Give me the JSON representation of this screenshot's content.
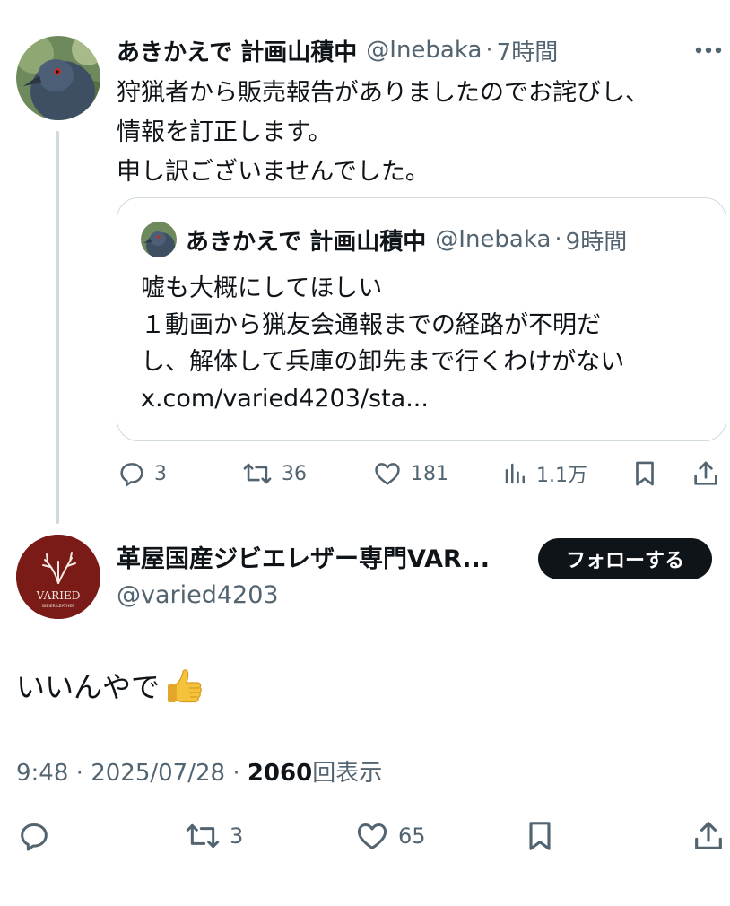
{
  "parent_tweet": {
    "author_name": "あきかえで 計画山積中",
    "handle": "@Inebaka",
    "separator": "·",
    "time": "7時間",
    "text_lines": [
      "狩猟者から販売報告がありましたのでお詫びし、",
      "情報を訂正します。",
      "申し訳ございませんでした。"
    ],
    "quote": {
      "author_name": "あきかえで 計画山積中",
      "handle": "@Inebaka",
      "separator": "·",
      "time": "9時間",
      "text_lines": [
        "嘘も大概にしてほしい",
        "１動画から猟友会通報までの経路が不明だ",
        "し、解体して兵庫の卸先まで行くわけがない",
        "x.com/varied4203/sta..."
      ]
    },
    "actions": {
      "reply_count": "3",
      "retweet_count": "36",
      "like_count": "181",
      "views_count": "1.1万"
    }
  },
  "main_tweet": {
    "author_name": "革屋国産ジビエレザー専門VAR...",
    "handle": "@varied4203",
    "follow_label": "フォローする",
    "avatar_logo_text": "VARIED",
    "avatar_logo_subtext": "GIBIER LEATHER",
    "text": "いいんやで",
    "emoji": "thumbs-up",
    "time": "9:48",
    "separator": "·",
    "date": "2025/07/28",
    "views_count": "2060",
    "views_label": "回表示",
    "actions": {
      "retweet_count": "3",
      "like_count": "65"
    }
  },
  "colors": {
    "text_primary": "#0f1419",
    "text_secondary": "#536471",
    "border": "#cfd9de",
    "follow_button_bg": "#0f1419",
    "avatar_brand": "#7a1b17"
  }
}
